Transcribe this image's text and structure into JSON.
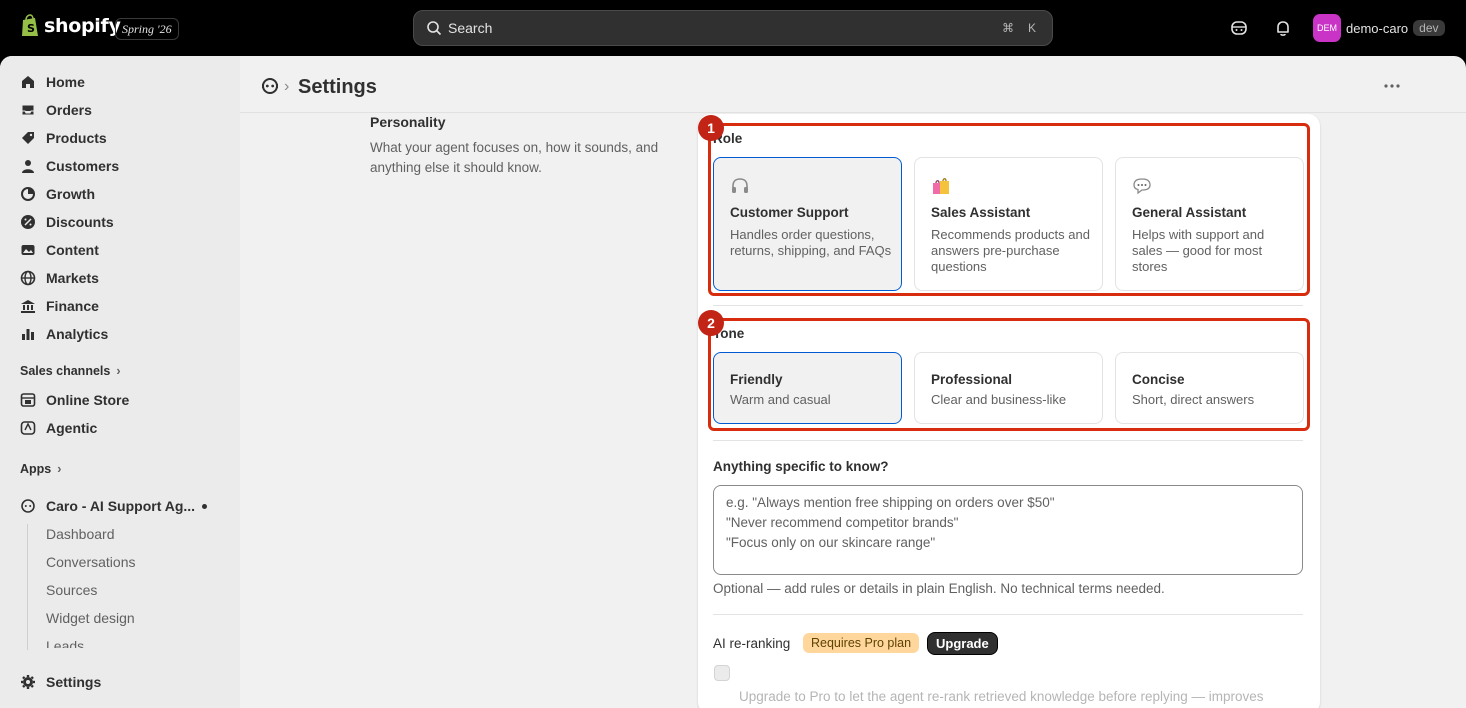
{
  "topbar": {
    "brand": "shopify",
    "edition": "Spring '26",
    "search_placeholder": "Search",
    "shortcut_cmd": "⌘",
    "shortcut_key": "K",
    "avatar_initials": "DEM",
    "store_name": "demo-caro",
    "env_badge": "dev"
  },
  "sidebar": {
    "items": [
      {
        "label": "Home",
        "icon": "home-icon"
      },
      {
        "label": "Orders",
        "icon": "inbox-icon"
      },
      {
        "label": "Products",
        "icon": "tag-icon"
      },
      {
        "label": "Customers",
        "icon": "person-icon"
      },
      {
        "label": "Growth",
        "icon": "chart-icon"
      },
      {
        "label": "Discounts",
        "icon": "discount-icon"
      },
      {
        "label": "Content",
        "icon": "image-icon"
      },
      {
        "label": "Markets",
        "icon": "globe-icon"
      },
      {
        "label": "Finance",
        "icon": "bank-icon"
      },
      {
        "label": "Analytics",
        "icon": "bars-icon"
      }
    ],
    "sales_channels_label": "Sales channels",
    "channels": [
      {
        "label": "Online Store"
      },
      {
        "label": "Agentic"
      }
    ],
    "apps_label": "Apps",
    "app_name": "Caro - AI Support Ag...",
    "app_subitems": [
      "Dashboard",
      "Conversations",
      "Sources",
      "Widget design",
      "Leads"
    ],
    "settings_label": "Settings"
  },
  "header": {
    "title": "Settings"
  },
  "section": {
    "title": "Personality",
    "description": "What your agent focuses on, how it sounds, and anything else it should know."
  },
  "role": {
    "label": "Role",
    "options": [
      {
        "title": "Customer Support",
        "desc": "Handles order questions, returns, shipping, and FAQs",
        "selected": true
      },
      {
        "title": "Sales Assistant",
        "desc": "Recommends products and answers pre-purchase questions",
        "selected": false
      },
      {
        "title": "General Assistant",
        "desc": "Helps with support and sales — good for most stores",
        "selected": false
      }
    ]
  },
  "tone": {
    "label": "Tone",
    "options": [
      {
        "title": "Friendly",
        "desc": "Warm and casual",
        "selected": true
      },
      {
        "title": "Professional",
        "desc": "Clear and business-like",
        "selected": false
      },
      {
        "title": "Concise",
        "desc": "Short, direct answers",
        "selected": false
      }
    ]
  },
  "specific": {
    "label": "Anything specific to know?",
    "placeholder_line1": "e.g. \"Always mention free shipping on orders over $50\"",
    "placeholder_line2": "\"Never recommend competitor brands\"",
    "placeholder_line3": "\"Focus only on our skincare range\"",
    "help": "Optional — add rules or details in plain English. No technical terms needed."
  },
  "reranking": {
    "label": "AI re-ranking",
    "tag": "Requires Pro plan",
    "button": "Upgrade",
    "description": "Upgrade to Pro to let the agent re-rank retrieved knowledge before replying — improves"
  },
  "annotations": {
    "marker1": "1",
    "marker2": "2",
    "color": "#d72c0d"
  },
  "colors": {
    "selected_border": "#005bd3",
    "pro_tag_bg": "#ffd79d",
    "avatar_bg": "#c934c7"
  }
}
